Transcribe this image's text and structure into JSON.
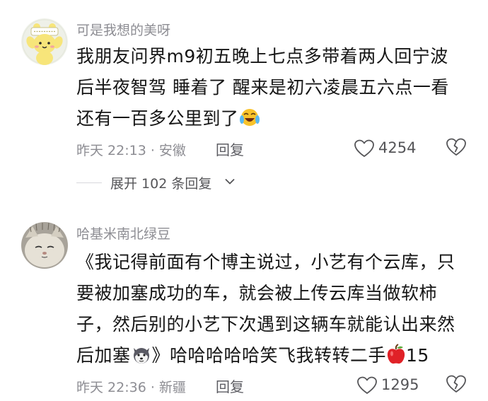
{
  "comments": [
    {
      "username": "可是我想的美呀",
      "content_lines": [
        "我朋友问界m9初五晚上七点多带着两人回宁波",
        "后半夜智驾 睡着了 醒来是初六凌晨五六点一看",
        "还有一百多公里到了"
      ],
      "emoji": "laughing-crying-emoji",
      "time": "昨天 22:13",
      "location": "安徽",
      "time_location": "昨天 22:13 · 安徽",
      "reply_label": "回复",
      "like_count": "4254",
      "expand_label": "展开 102 条回复"
    },
    {
      "username": "哈基米南北绿豆",
      "content_lines": [
        "《我记得前面有个博主说过，小艺有个云库，只",
        "要被加塞成功的车，就会被上传云库当做软柿",
        "子，然后别的小艺下次遇到这辆车就能认出来然"
      ],
      "last_line_before_emoji": "后加塞",
      "last_line_after_emoji": "》哈哈哈哈哈笑飞我转转二手",
      "apple_count": "15",
      "emojis": [
        "husky-dog-emoji",
        "red-apple-emoji"
      ],
      "time": "昨天 22:36",
      "location": "新疆",
      "time_location": "昨天 22:36 · 新疆",
      "reply_label": "回复",
      "like_count": "1295"
    }
  ],
  "icons": {
    "like": "heart-outline-icon",
    "dislike": "broken-heart-icon",
    "expand": "chevron-down-icon"
  },
  "colors": {
    "text": "#161616",
    "muted": "#8d8d93",
    "icon": "#555558"
  }
}
